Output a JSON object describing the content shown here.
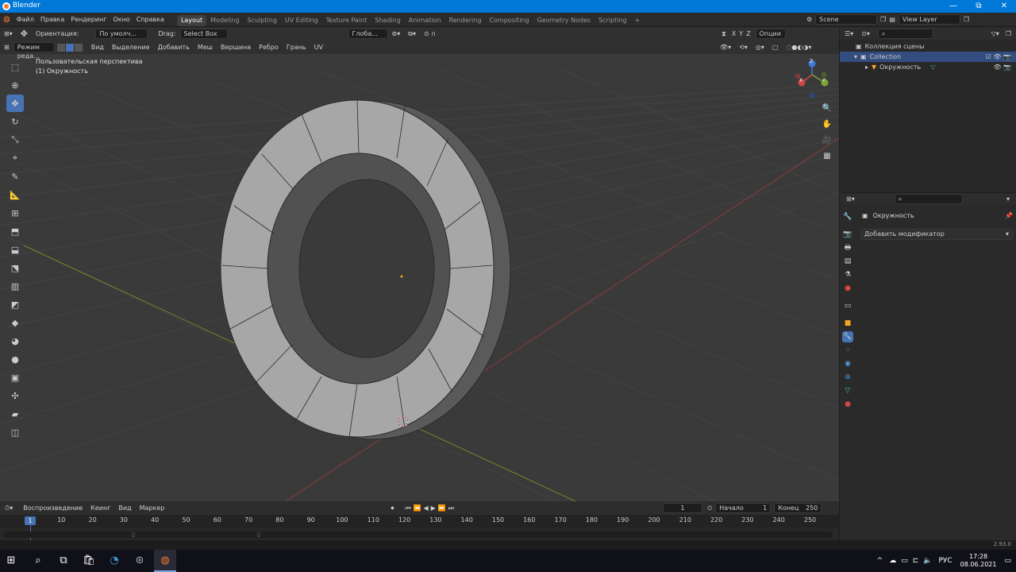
{
  "window": {
    "title": "Blender",
    "min": "—",
    "max": "⧉",
    "close": "✕"
  },
  "menu": [
    "Файл",
    "Правка",
    "Рендеринг",
    "Окно",
    "Справка"
  ],
  "workspaces": [
    "Layout",
    "Modeling",
    "Sculpting",
    "UV Editing",
    "Texture Paint",
    "Shading",
    "Animation",
    "Rendering",
    "Compositing",
    "Geometry Nodes",
    "Scripting"
  ],
  "active_workspace": "Layout",
  "add_workspace": "+",
  "scene": "Scene",
  "view_layer": "View Layer",
  "tool_header": {
    "orientation_label": "Ориентация:",
    "orientation_value": "По умолч...",
    "drag_label": "Drag:",
    "drag_value": "Select Box",
    "transform_orientation": "Глоба...",
    "axes": [
      "X",
      "Y",
      "Z"
    ],
    "options": "Опции"
  },
  "mode_header": {
    "mode": "Режим реда...",
    "items": [
      "Вид",
      "Выделение",
      "Добавить",
      "Меш",
      "Вершина",
      "Ребро",
      "Грань",
      "UV"
    ]
  },
  "viewport": {
    "perspective": "Пользовательская перспектива",
    "object_info": "(1) Окружность",
    "gizmo_axes": {
      "x": "X",
      "y": "Y",
      "z": "Z"
    }
  },
  "outliner": {
    "root": "Коллекция сцены",
    "collection": "Collection",
    "object": "Окружность"
  },
  "properties": {
    "object": "Окружность",
    "add_modifier": "Добавить модификатор"
  },
  "timeline": {
    "menus": [
      "Воспроизведение",
      "Кеинг",
      "Вид",
      "Маркер"
    ],
    "current_frame": "1",
    "start_label": "Начало",
    "start": "1",
    "end_label": "Конец",
    "end": "250",
    "ticks": [
      "10",
      "20",
      "30",
      "40",
      "50",
      "60",
      "70",
      "80",
      "90",
      "100",
      "110",
      "120",
      "130",
      "140",
      "150",
      "160",
      "170",
      "180",
      "190",
      "200",
      "210",
      "220",
      "230",
      "240",
      "250"
    ],
    "playhead_label": "1"
  },
  "status": {
    "version": "2.93.0"
  },
  "taskbar": {
    "lang": "РУС",
    "time": "17:28",
    "date": "08.06.2021"
  },
  "colors": {
    "accent": "#4772b3",
    "windows_blue": "#0078d7",
    "grid_x": "#8e3a3a",
    "grid_y": "#6b8a2a"
  }
}
